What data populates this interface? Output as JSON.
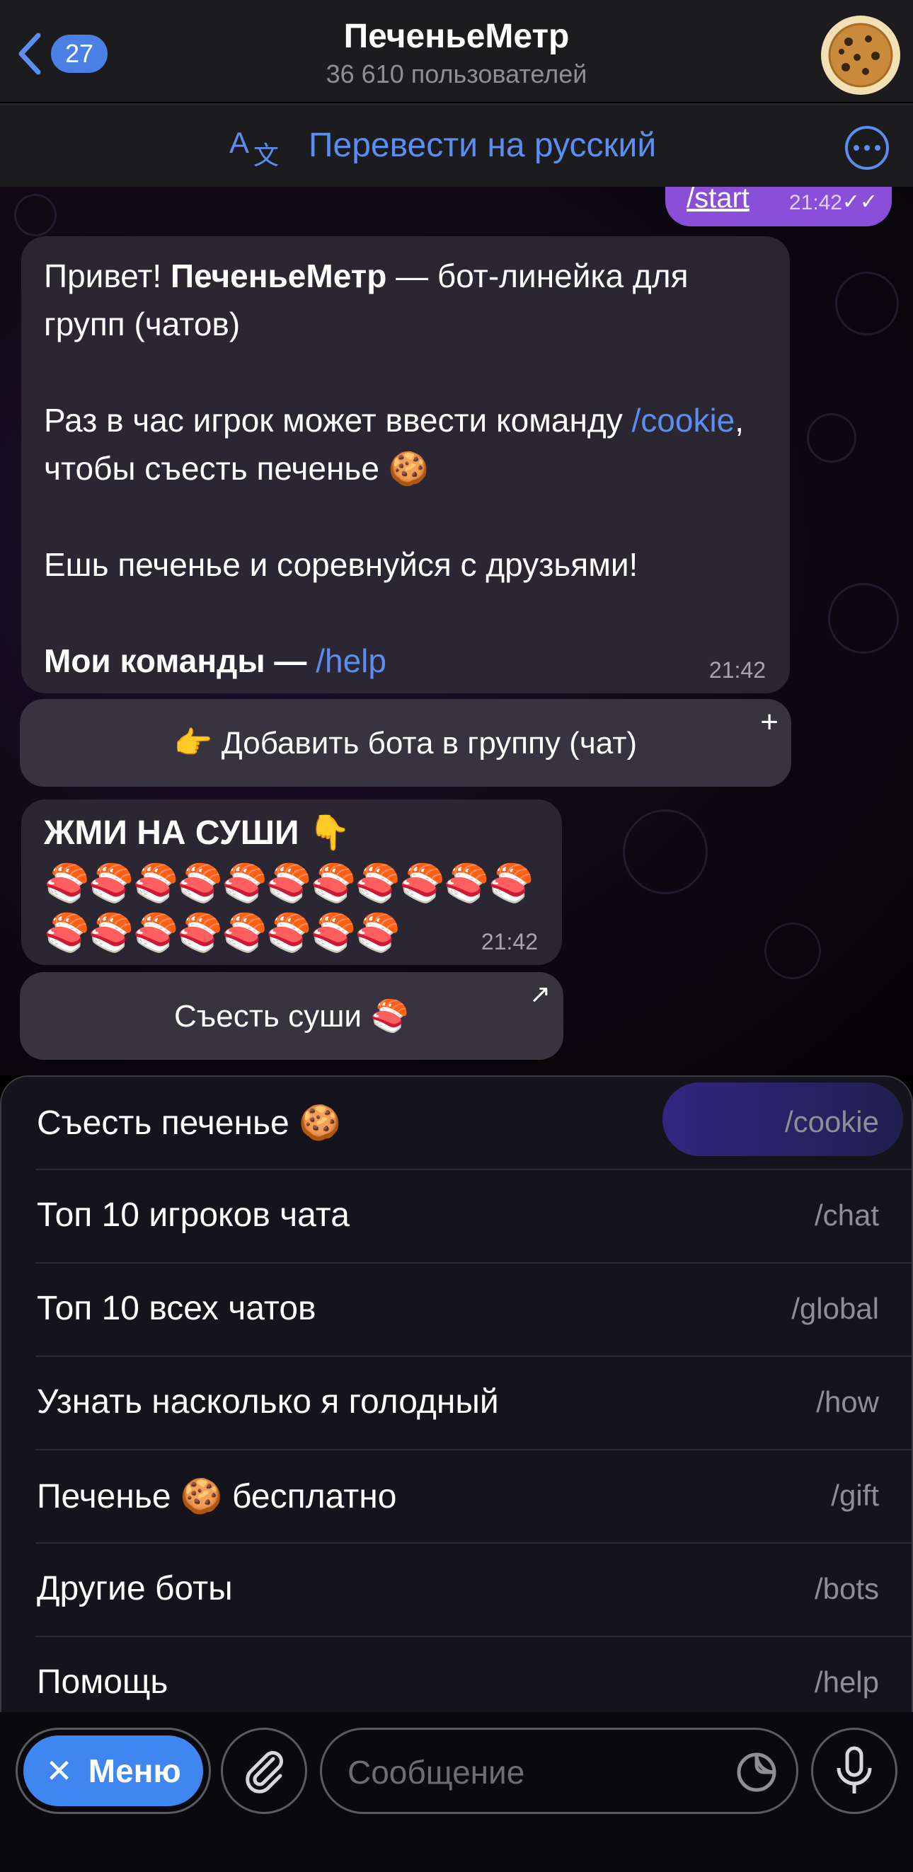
{
  "header": {
    "back_count": "27",
    "title": "ПеченьеМетр",
    "subtitle": "36 610 пользователей"
  },
  "translate_bar": {
    "label": "Перевести на русский"
  },
  "sent_message": {
    "text": "/start",
    "time": "21:42"
  },
  "welcome_message": {
    "line1_prefix": "Привет! ",
    "line1_bold": "ПеченьеМетр",
    "line1_suffix": " — бот-линейка для групп (чатов)",
    "line2_prefix": "Раз в час игрок может ввести команду ",
    "line2_link": "/cookie",
    "line2_suffix": ", чтобы съесть печенье 🍪",
    "line3": "Ешь печенье и соревнуйся с друзьями!",
    "line4_bold": "Мои команды — ",
    "line4_link": "/help",
    "time": "21:42"
  },
  "add_bot_button": {
    "label": "👉 Добавить бота в группу (чат)"
  },
  "sushi_message": {
    "heading": "ЖМИ НА СУШИ 👇",
    "sushi": "🍣🍣🍣🍣🍣🍣🍣🍣🍣🍣🍣🍣🍣🍣🍣🍣🍣🍣🍣",
    "time": "21:42"
  },
  "eat_sushi_button": {
    "label": "Съесть суши 🍣"
  },
  "commands": [
    {
      "name": "Съесть печенье 🍪",
      "command": "/cookie"
    },
    {
      "name": "Топ 10 игроков чата",
      "command": "/chat"
    },
    {
      "name": "Топ 10 всех чатов",
      "command": "/global"
    },
    {
      "name": "Узнать насколько я голодный",
      "command": "/how"
    },
    {
      "name": "Печенье 🍪 бесплатно",
      "command": "/gift"
    },
    {
      "name": "Другие боты",
      "command": "/bots"
    },
    {
      "name": "Помощь",
      "command": "/help"
    }
  ],
  "input_bar": {
    "menu_label": "Меню",
    "placeholder": "Сообщение"
  },
  "colors": {
    "accent": "#3f86f0",
    "link": "#5b8ef0",
    "sent_bubble": "#8a4fd8"
  }
}
